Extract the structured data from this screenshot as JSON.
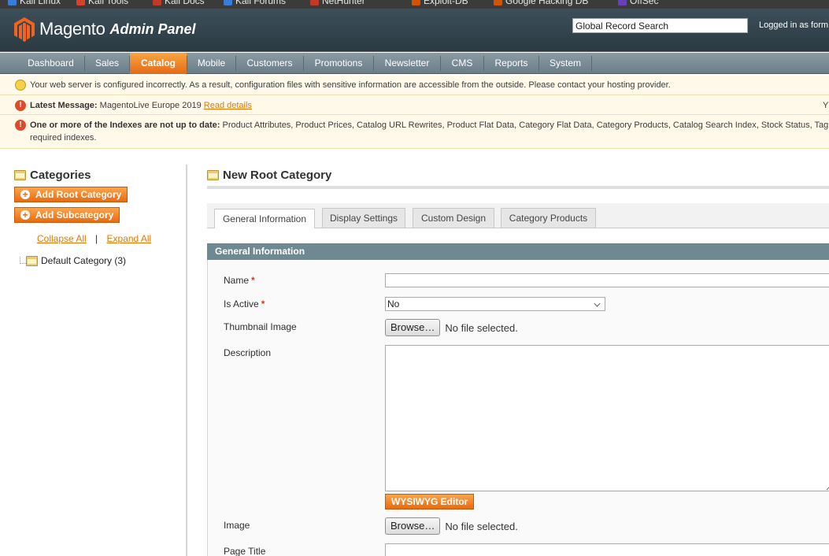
{
  "bookmarks": [
    {
      "label": "Kali Linux",
      "icon": "kali-icon",
      "color": "#3a7bd5"
    },
    {
      "label": "Kali Tools",
      "icon": "kali-tools-icon",
      "color": "#d9412c"
    },
    {
      "label": "Kali Docs",
      "icon": "kali-docs-icon",
      "color": "#c0392b"
    },
    {
      "label": "Kali Forums",
      "icon": "kali-forums-icon",
      "color": "#3a7bd5"
    },
    {
      "label": "NetHunter",
      "icon": "nethunter-icon",
      "color": "#c0392b"
    },
    {
      "label": "Exploit-DB",
      "icon": "exploit-db-icon",
      "color": "#d35400"
    },
    {
      "label": "Google Hacking DB",
      "icon": "ghdb-icon",
      "color": "#d35400"
    },
    {
      "label": "OffSec",
      "icon": "offsec-icon",
      "color": "#6a3fbf"
    }
  ],
  "header": {
    "logo_text": "Magento",
    "logo_sub": "Admin Panel",
    "search_value": "Global Record Search",
    "logged_in": "Logged in as form"
  },
  "nav": {
    "items": [
      "Dashboard",
      "Sales",
      "Catalog",
      "Mobile",
      "Customers",
      "Promotions",
      "Newsletter",
      "CMS",
      "Reports",
      "System"
    ],
    "active": "Catalog"
  },
  "notices": {
    "config_warning": "Your web server is configured incorrectly. As a result, configuration files with sensitive information are accessible from the outside. Please contact your hosting provider.",
    "latest_label": "Latest Message:",
    "latest_text": "MagentoLive Europe 2019",
    "latest_link": "Read details",
    "latest_right": "Y",
    "index_label": "One or more of the Indexes are not up to date:",
    "index_text": "Product Attributes, Product Prices, Catalog URL Rewrites, Product Flat Data, Category Flat Data, Category Products, Catalog Search Index, Stock Status, Tag",
    "index_text2": "required indexes."
  },
  "sidebar": {
    "title": "Categories",
    "add_root": "Add Root Category",
    "add_sub": "Add Subcategory",
    "collapse_all": "Collapse All",
    "separator": "|",
    "expand_all": "Expand All",
    "tree_node": "Default Category (3)"
  },
  "main": {
    "title": "New Root Category",
    "tabs": [
      "General Information",
      "Display Settings",
      "Custom Design",
      "Category Products"
    ],
    "active_tab": "General Information",
    "section_title": "General Information",
    "fields": {
      "name_label": "Name",
      "required_mark": "*",
      "is_active_label": "Is Active",
      "is_active_value": "No",
      "thumbnail_label": "Thumbnail Image",
      "browse": "Browse…",
      "no_file": "No file selected.",
      "description_label": "Description",
      "wysiwyg": "WYSIWYG Editor",
      "image_label": "Image",
      "page_title_label": "Page Title"
    }
  },
  "colors": {
    "accent": "#e46b16",
    "header_bg": "#34454e",
    "section_head": "#6f8992"
  }
}
